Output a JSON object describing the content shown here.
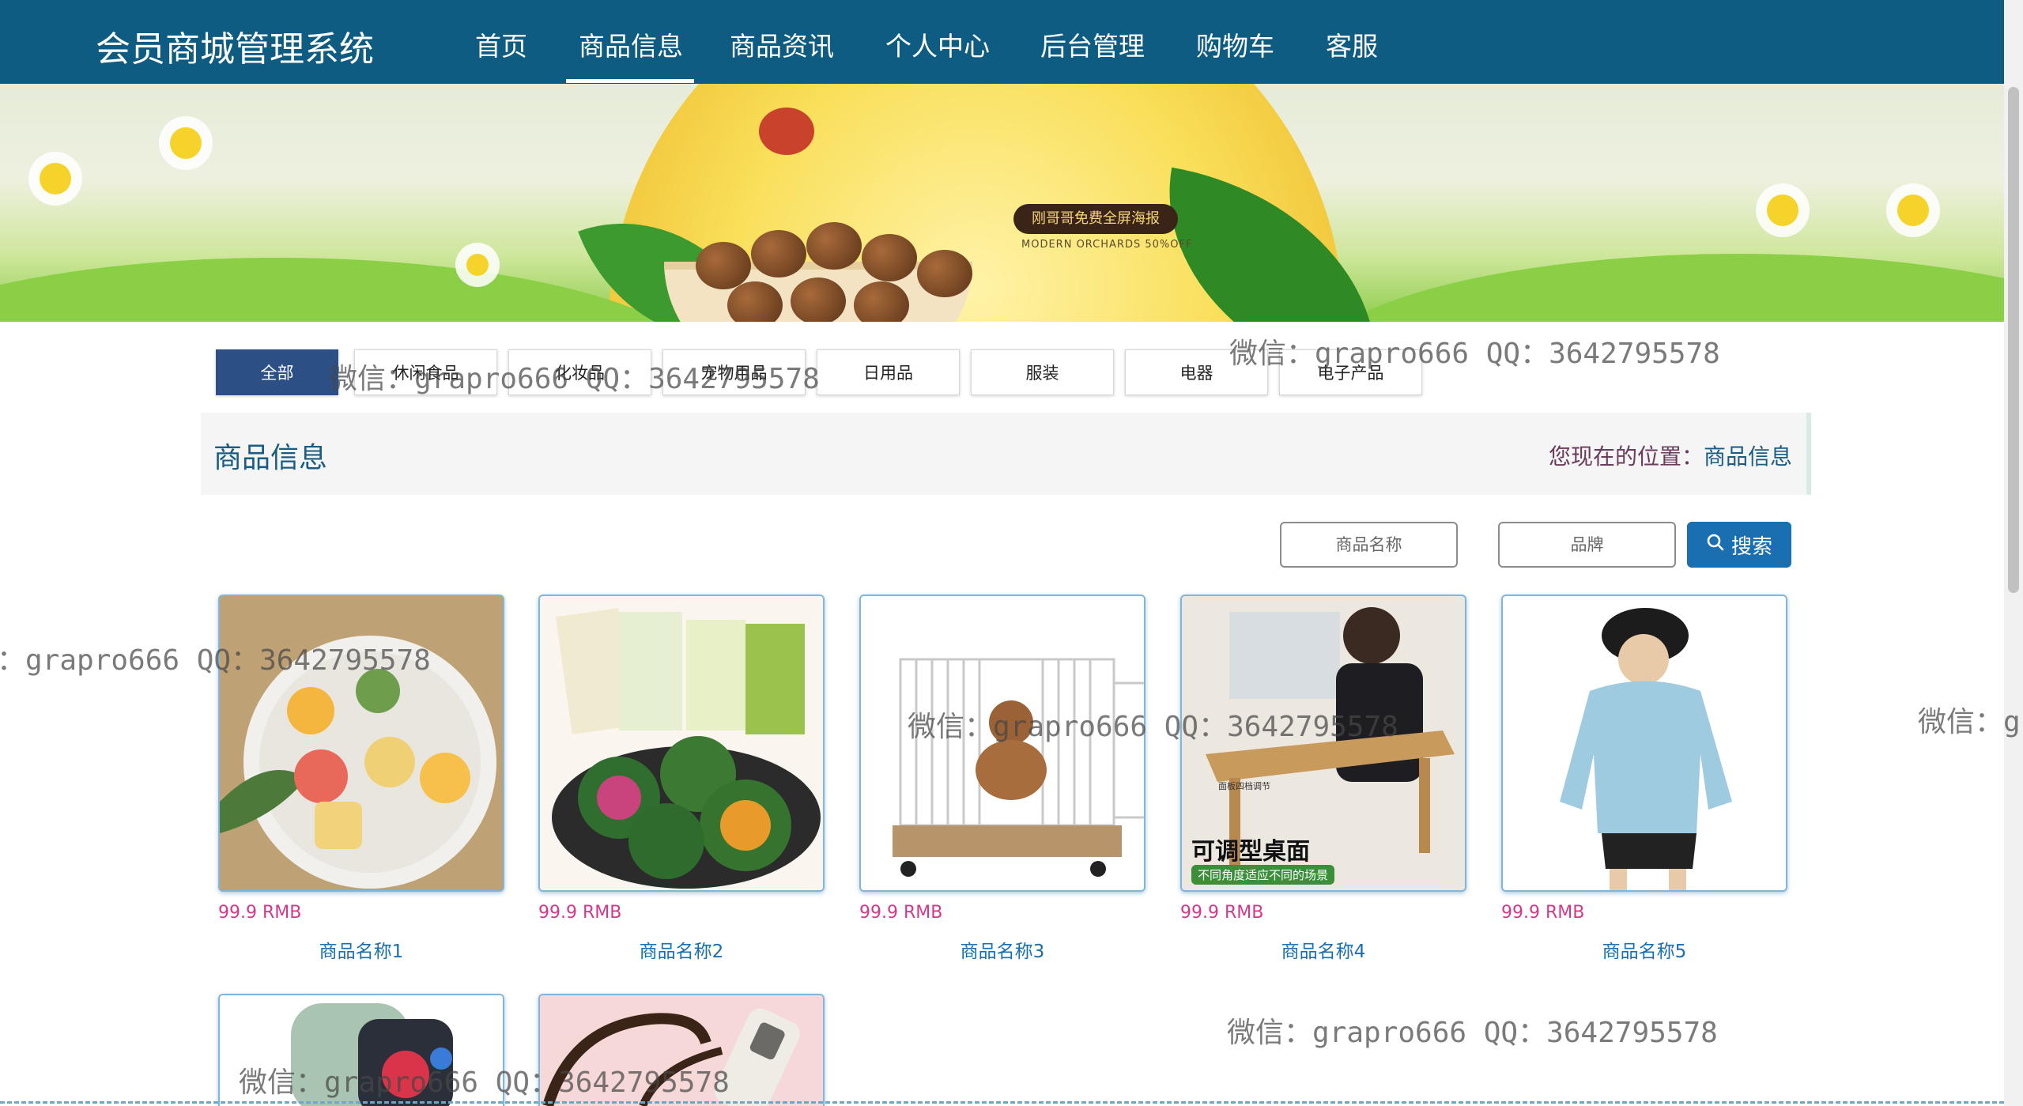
{
  "app": {
    "title": "会员商城管理系统"
  },
  "nav": {
    "items": [
      "首页",
      "商品信息",
      "商品资讯",
      "个人中心",
      "后台管理",
      "购物车",
      "客服"
    ],
    "active": "商品信息"
  },
  "banner": {
    "tag": "刚哥哥免费全屏海报",
    "subtitle": "MODERN ORCHARDS 50%OFF"
  },
  "categories": [
    "全部",
    "休闲食品",
    "化妆品",
    "宠物用品",
    "日用品",
    "服装",
    "电器",
    "电子产品"
  ],
  "active_category": "全部",
  "section": {
    "title": "商品信息",
    "breadcrumb_prefix": "您现在的位置：",
    "breadcrumb_current": "商品信息"
  },
  "search": {
    "name_placeholder": "商品名称",
    "brand_placeholder": "品牌",
    "button_label": "搜索"
  },
  "products": [
    {
      "price": "99.9 RMB",
      "name": "商品名称1",
      "image": "mooncakes"
    },
    {
      "price": "99.9 RMB",
      "name": "商品名称2",
      "image": "qingtuan"
    },
    {
      "price": "99.9 RMB",
      "name": "商品名称3",
      "image": "dog-cage"
    },
    {
      "price": "99.9 RMB",
      "name": "商品名称4",
      "image": "laptop-desk",
      "overlay": "可调型桌面",
      "overlay_sub": "不同角度适应不同的场景",
      "overlay_small": "面板四档调节"
    },
    {
      "price": "99.9 RMB",
      "name": "商品名称5",
      "image": "hoodie"
    },
    {
      "image": "smartwatch"
    },
    {
      "image": "glasses"
    }
  ],
  "watermark": {
    "full": "微信：grapro666 QQ：3642795578",
    "partial_left": "：grapro666 QQ：3642795578",
    "partial_right": "微信：g"
  },
  "colors": {
    "nav_bg": "#0f5c82",
    "active_category": "#2c4f86",
    "price": "#d3398b",
    "link": "#1a6fb0",
    "search_button": "#1a6fb0"
  }
}
